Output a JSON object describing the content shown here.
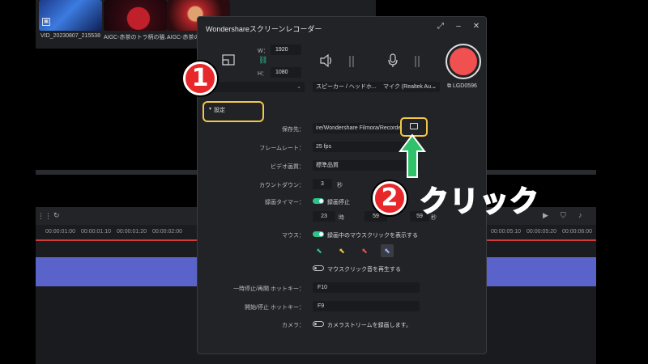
{
  "media": {
    "items": [
      {
        "label": "VID_20230807_215538"
      },
      {
        "label": "AIGC-赤茶のトラ柄の猫..."
      },
      {
        "label": "AIGC-赤茶の"
      }
    ]
  },
  "timeline": {
    "ruler_ticks": [
      "00:00:01:00",
      "00:00:01:10",
      "00:00:01:20",
      "00:00:02:00",
      "00:00:05:10",
      "00:00:05:20",
      "00:00:06:00"
    ]
  },
  "dialog": {
    "title": "Wondershareスクリーンレコーダー",
    "width_label": "W：",
    "width_value": "1920",
    "height_label": "H：",
    "height_value": "1080",
    "screen_dropdown": "リーン",
    "speaker_dropdown": "スピーカー / ヘッドホ...",
    "mic_dropdown": "マイク (Realtek Au...",
    "camera_device": "LGD0596",
    "settings_label": "設定",
    "save_to_label": "保存先：",
    "save_to_value": "ire/Wondershare Filmora/Recorded",
    "framerate_label": "フレームレート：",
    "framerate_value": "25 fps",
    "quality_label": "ビデオ画質：",
    "quality_value": "標準品質",
    "countdown_label": "カウントダウン：",
    "countdown_value": "3",
    "countdown_unit": "秒",
    "timer_label": "録画タイマー：",
    "timer_toggle_text": "録画停止",
    "timer_hours": "23",
    "timer_hours_unit": "時",
    "timer_minutes": "59",
    "timer_seconds": "59",
    "timer_seconds_unit": "秒",
    "mouse_label": "マウス：",
    "mouse_toggle_text": "録画中のマウスクリックを表示する",
    "click_sound_text": "マウスクリック音を再生する",
    "pause_hotkey_label": "一時停止/再開 ホットキー：",
    "pause_hotkey_value": "F10",
    "start_hotkey_label": "開始/停止 ホットキー：",
    "start_hotkey_value": "F9",
    "camera_label": "カメラ：",
    "camera_toggle_text": "カメラストリームを録画します。"
  },
  "annotations": {
    "badge1": "1",
    "badge2": "2",
    "click_text": "クリック"
  },
  "colors": {
    "accent_green": "#2fc28a",
    "record_red": "#f05050",
    "highlight_yellow": "#f2c744",
    "annotation_red": "#e8272b",
    "timeline_clip": "#5a63c9"
  }
}
